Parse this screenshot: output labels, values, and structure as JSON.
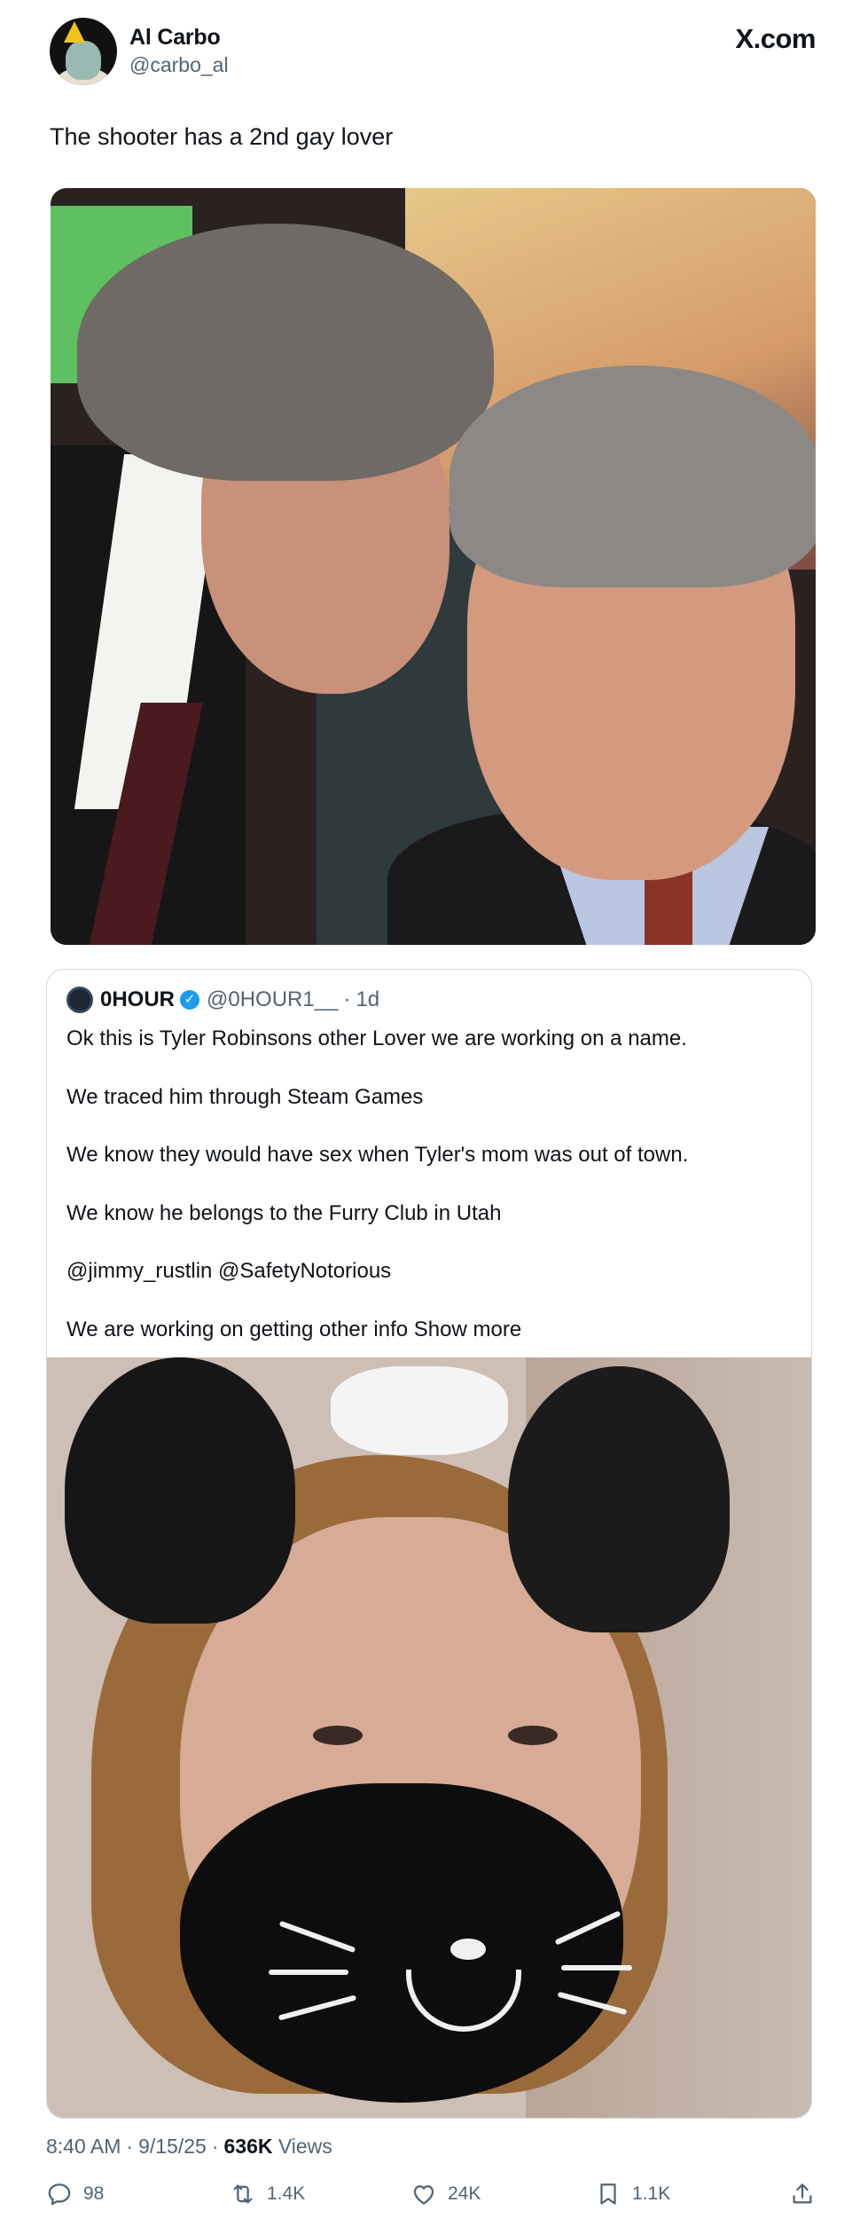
{
  "site_logo": "X.com",
  "author": {
    "name": "Al Carbo",
    "handle": "@carbo_al",
    "avatar_icon": "squidward-avatar"
  },
  "tweet": {
    "text": "The shooter has a 2nd gay lover"
  },
  "quoted": {
    "name": "0HOUR",
    "verified_icon": "verified-badge-icon",
    "handle": "@0HOUR1__",
    "separator": "·",
    "time": "1d",
    "paragraphs": [
      "Ok this is Tyler Robinsons other Lover we are working on a name.",
      "We traced him through Steam Games",
      "We know they would have sex when Tyler's mom was out of town.",
      "We know he belongs to the Furry Club in Utah",
      "@jimmy_rustlin @SafetyNotorious",
      "We are working on getting other info"
    ],
    "show_more": "Show more"
  },
  "meta": {
    "time": "8:40 AM",
    "date": "9/15/25",
    "views_count": "636K",
    "views_label": "Views",
    "separator": "·"
  },
  "actions": {
    "replies": "98",
    "reposts": "1.4K",
    "likes": "24K",
    "bookmarks": "1.1K"
  },
  "colors": {
    "text": "#0f1419",
    "secondary": "#536471",
    "verified": "#1d9bf0",
    "border": "#cfd9de"
  }
}
